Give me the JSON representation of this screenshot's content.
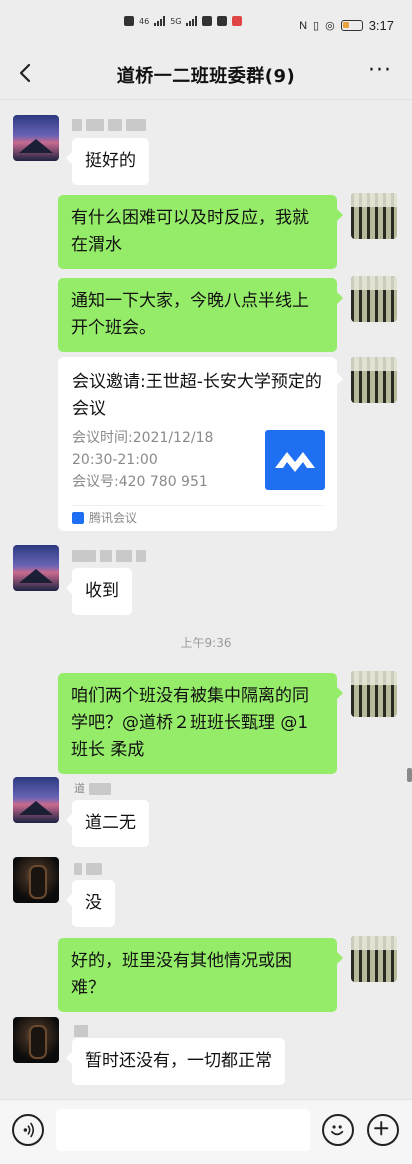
{
  "status": {
    "time": "3:17",
    "network": "46",
    "network2": "5G"
  },
  "header": {
    "title": "道桥一二班班委群(9)",
    "more_label": "···"
  },
  "messages": [
    {
      "text": "挺好的"
    },
    {
      "text": "有什么困难可以及时反应，我就在渭水"
    },
    {
      "text": "通知一下大家，今晚八点半线上开个班会。"
    },
    {
      "text": "收到"
    },
    {
      "text": "咱们两个班没有被集中隔离的同学吧？@道桥２班班长甄理 @1 班长 柔成"
    },
    {
      "text": "道二无"
    },
    {
      "text": "没"
    },
    {
      "text": "好的，班里没有其他情况或困难？"
    },
    {
      "text": "暂时还没有，一切都正常"
    }
  ],
  "card": {
    "title": "会议邀请:王世超-长安大学预定的会议",
    "time_line": "会议时间:2021/12/18",
    "time_range": "20:30-21:00",
    "id_line": "会议号:420 780 951",
    "source": "腾讯会议",
    "logo_color": "#1f6ff2"
  },
  "timestamp": "上午9:36",
  "names": {
    "partial_name": "道"
  },
  "colors": {
    "outgoing_bubble": "#95ec69",
    "incoming_bubble": "#ffffff",
    "background": "#ededed"
  },
  "icons": {
    "back": "chevron-left-icon",
    "more": "more-dots-icon",
    "voice": "voice-icon",
    "emoji": "emoji-icon",
    "add": "plus-icon"
  }
}
